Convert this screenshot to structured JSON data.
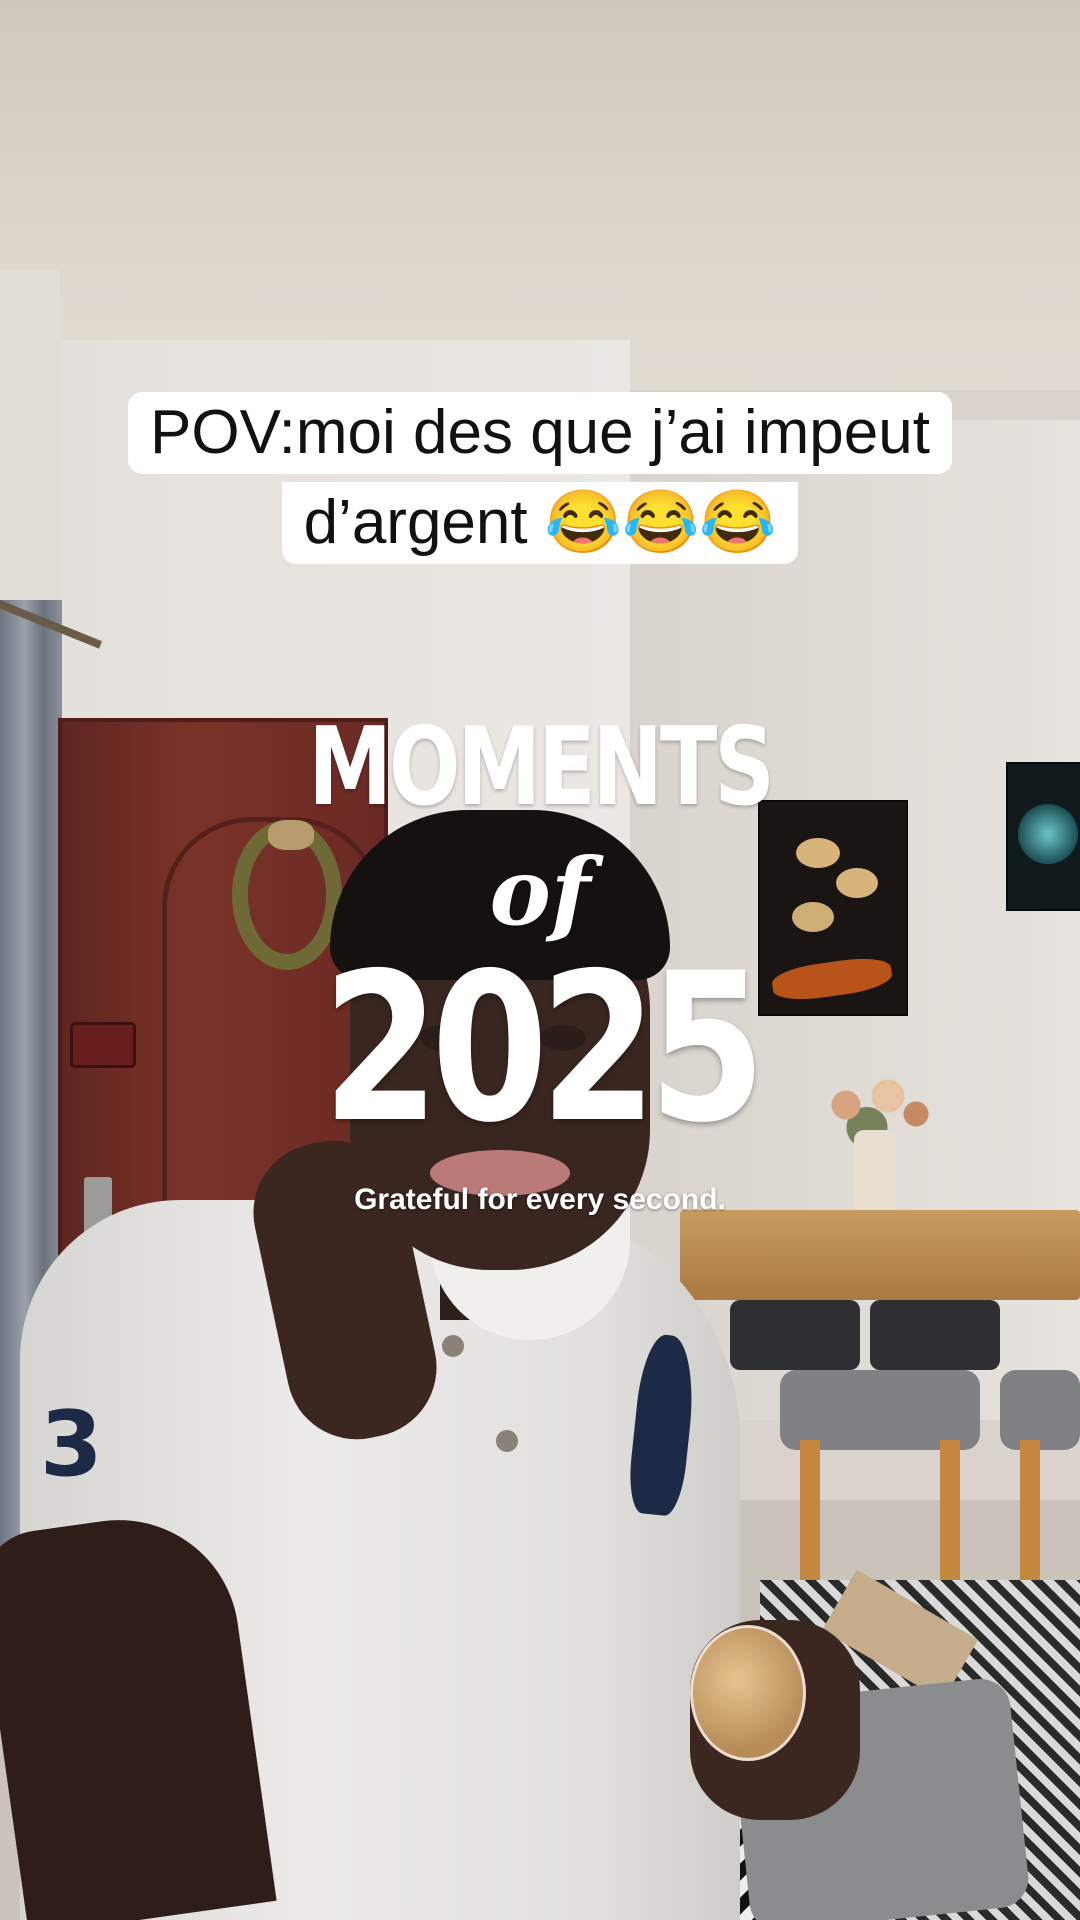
{
  "caption": {
    "line1": "POV:moi des que j’ai impeut",
    "line2": "d’argent 😂😂😂"
  },
  "overlay": {
    "title": "MOMENTS",
    "connector": "of",
    "year": "2025",
    "subtitle": "Grateful for every second."
  }
}
